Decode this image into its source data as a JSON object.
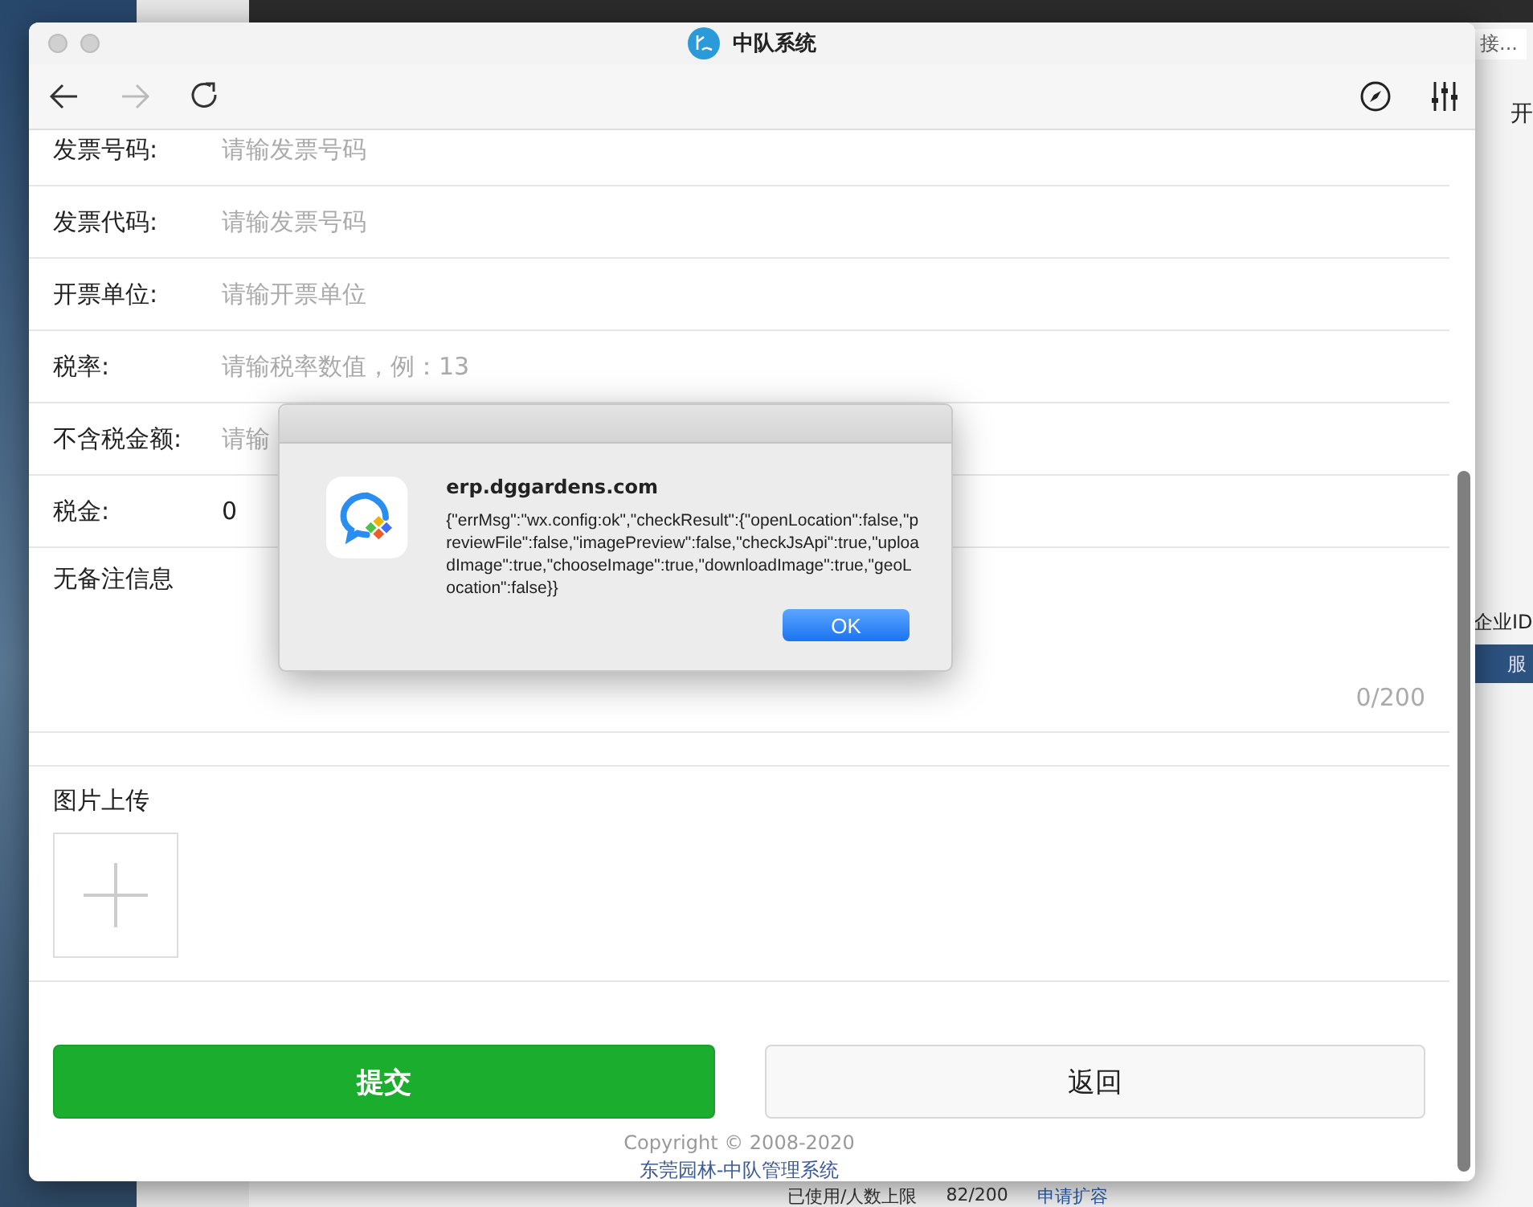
{
  "background_window": {
    "search_hint": "接...",
    "heading": "开",
    "company_label": "企业ID",
    "tab_label": "服",
    "usage_label": "已使用/人数上限",
    "usage_value": "82/200",
    "expand_link": "申请扩容"
  },
  "window": {
    "title": "中队系统"
  },
  "toolbar": [
    {
      "kind": "back",
      "disabled": false
    },
    {
      "kind": "forward",
      "disabled": true
    },
    {
      "kind": "reload",
      "disabled": false
    }
  ],
  "form": {
    "fields": [
      {
        "label": "发票号码:",
        "placeholder": "请输发票号码"
      },
      {
        "label": "发票代码:",
        "placeholder": "请输发票号码"
      },
      {
        "label": "开票单位:",
        "placeholder": "请输开票单位"
      },
      {
        "label": "税率:",
        "placeholder": "请输税率数值，例：13"
      },
      {
        "label": "不含税金额:",
        "placeholder": "请输"
      },
      {
        "label": "税金:",
        "value": "0"
      }
    ],
    "remarks": {
      "placeholder": "无备注信息",
      "counter": "0/200"
    },
    "upload": {
      "label": "图片上传"
    },
    "buttons": [
      {
        "label": "提交",
        "kind": "primary"
      },
      {
        "label": "返回",
        "kind": "secondary"
      }
    ],
    "footer": {
      "copyright": "Copyright © 2008-2020",
      "link": "东莞园林-中队管理系统"
    }
  },
  "dialog": {
    "title": "erp.dggardens.com",
    "message": "{\"errMsg\":\"wx.config:ok\",\"checkResult\":{\"openLocation\":false,\"previewFile\":false,\"imagePreview\":false,\"checkJsApi\":true,\"uploadImage\":true,\"chooseImage\":true,\"downloadImage\":true,\"geoLocation\":false}}",
    "button": "OK"
  }
}
